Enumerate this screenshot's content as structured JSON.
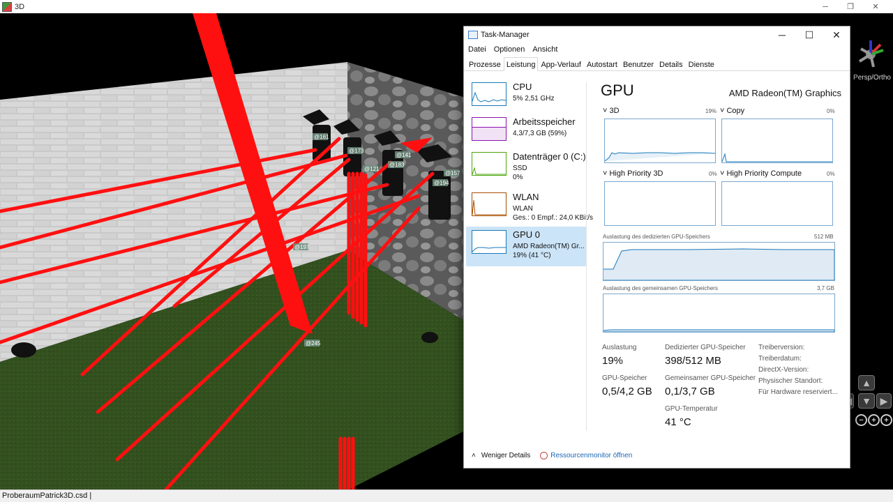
{
  "app": {
    "title": "3D",
    "status_file": "ProberaumPatrick3D.csd |",
    "persp_label": "Persp/Ortho"
  },
  "scene": {
    "labels": [
      "@161",
      "@173",
      "@121",
      "@183",
      "@157",
      "@194",
      "@197",
      "@245",
      "@141"
    ],
    "beam_color": "#ff1010",
    "floor_color": "#2f4a1c"
  },
  "taskmanager": {
    "title": "Task-Manager",
    "menu": [
      "Datei",
      "Optionen",
      "Ansicht"
    ],
    "tabs": [
      "Prozesse",
      "Leistung",
      "App-Verlauf",
      "Autostart",
      "Benutzer",
      "Details",
      "Dienste"
    ],
    "active_tab": "Leistung",
    "resources": [
      {
        "name": "CPU",
        "sub1": "5%  2,51 GHz",
        "sub2": "",
        "color": "#1779ba"
      },
      {
        "name": "Arbeitsspeicher",
        "sub1": "4,3/7,3 GB (59%)",
        "sub2": "",
        "color": "#8b12ae"
      },
      {
        "name": "Datenträger 0 (C:)",
        "sub1": "SSD",
        "sub2": "0%",
        "color": "#4da60c"
      },
      {
        "name": "WLAN",
        "sub1": "WLAN",
        "sub2": "Ges.: 0  Empf.: 24,0 KBit/s",
        "color": "#a74f01"
      },
      {
        "name": "GPU 0",
        "sub1": "AMD Radeon(TM) Gr...",
        "sub2": "19%  (41 °C)",
        "color": "#1779ba"
      }
    ],
    "gpu": {
      "title": "GPU",
      "name": "AMD Radeon(TM) Graphics",
      "graphs": [
        {
          "label": "3D",
          "pct": "19%"
        },
        {
          "label": "Copy",
          "pct": "0%"
        },
        {
          "label": "High Priority 3D",
          "pct": "0%"
        },
        {
          "label": "High Priority Compute",
          "pct": "0%"
        }
      ],
      "dedicated_label": "Auslastung des dedizierten GPU-Speichers",
      "dedicated_max": "512 MB",
      "shared_label": "Auslastung des gemeinsamen GPU-Speichers",
      "shared_max": "3,7 GB",
      "stats": {
        "auslastung_label": "Auslastung",
        "auslastung_value": "19%",
        "ded_label": "Dedizierter GPU-Speicher",
        "ded_value": "398/512 MB",
        "gpu_mem_label": "GPU-Speicher",
        "gpu_mem_value": "0,5/4,2 GB",
        "shared_label": "Gemeinsamer GPU-Speicher",
        "shared_value": "0,1/3,7 GB",
        "temp_label": "GPU-Temperatur",
        "temp_value": "41 °C",
        "driver_version": "Treiberversion:",
        "driver_date": "Treiberdatum:",
        "directx": "DirectX-Version:",
        "location": "Physischer Standort:",
        "reserved": "Für Hardware reserviert..."
      }
    },
    "footer": {
      "less_details": "Weniger Details",
      "resmon": "Ressourcenmonitor öffnen"
    }
  }
}
